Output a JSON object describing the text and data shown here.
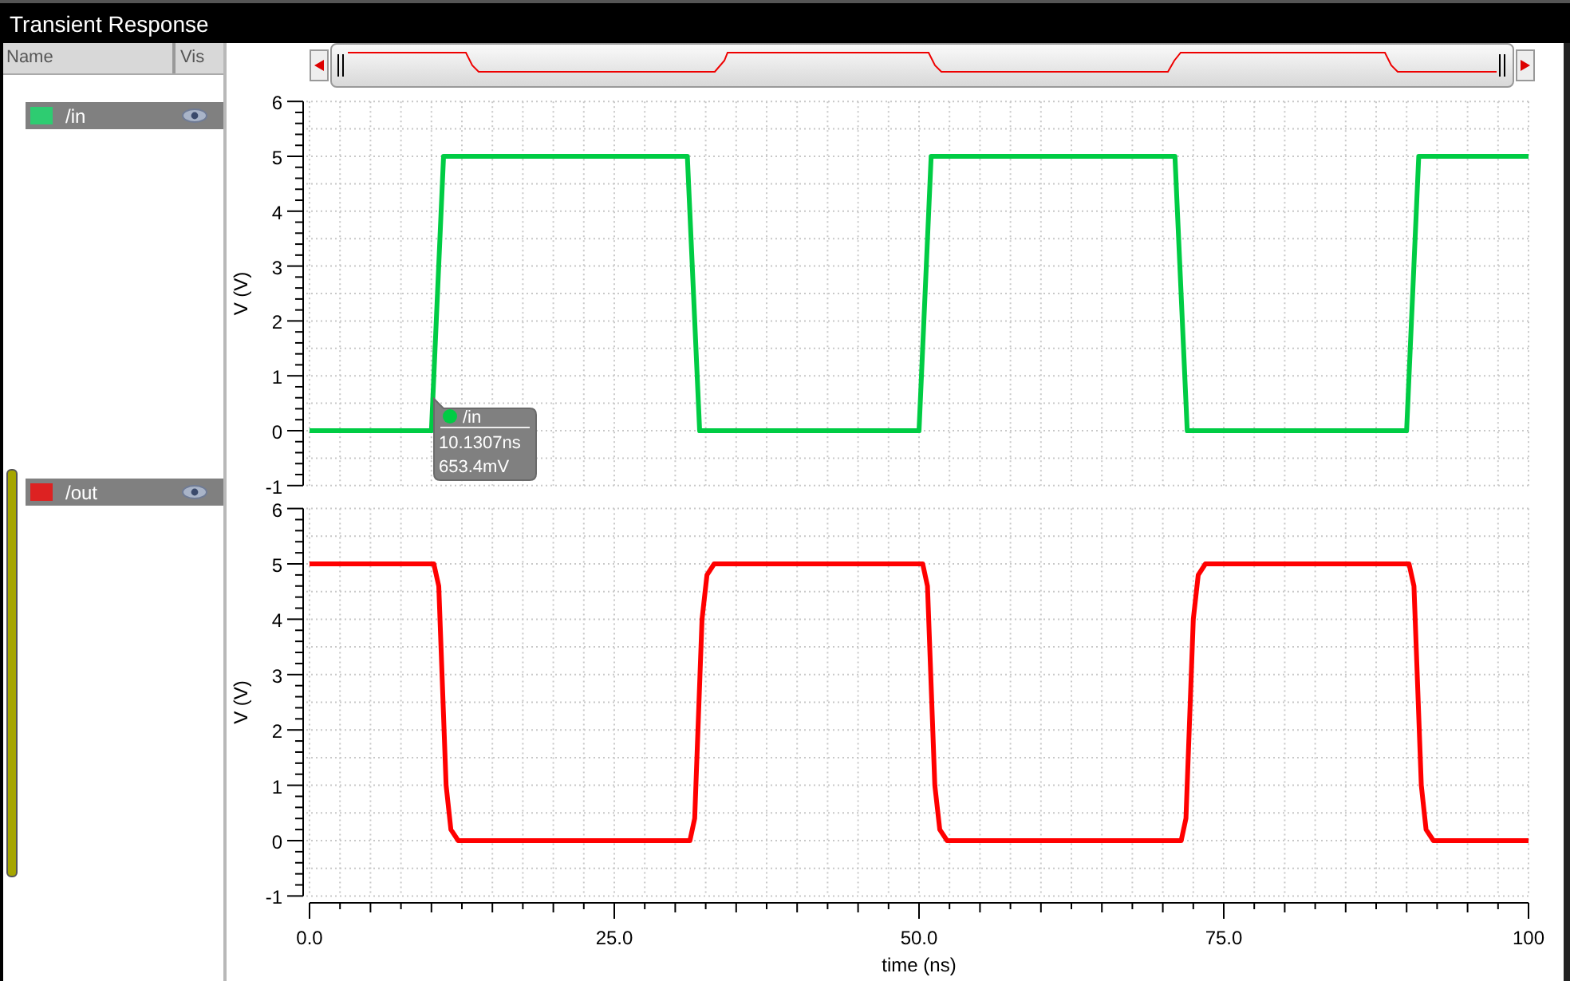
{
  "window": {
    "title": "Transient Response"
  },
  "signal_list": {
    "columns": [
      "Name",
      "Vis"
    ],
    "signals": [
      {
        "name": "/in",
        "color": "#2ecc71"
      },
      {
        "name": "/out",
        "color": "#dd2222"
      }
    ]
  },
  "plots": [
    {
      "chart_data": {
        "type": "line",
        "grid": true,
        "ylabel": "V (V)",
        "x": [
          0,
          10,
          11,
          31,
          32,
          50,
          51,
          71,
          72,
          90,
          91,
          100
        ],
        "series": [
          {
            "color": "#00cc44",
            "values": [
              0,
              0,
              5,
              5,
              0,
              0,
              5,
              5,
              0,
              0,
              5,
              5
            ]
          }
        ],
        "xlim": [
          0,
          100
        ],
        "ylim": [
          -1,
          6
        ],
        "yticks": [
          -1,
          0,
          1,
          2,
          3,
          4,
          5,
          6
        ]
      },
      "marker": {
        "signal": "/in",
        "time": "10.1307ns",
        "value": "653.4mV"
      }
    },
    {
      "chart_data": {
        "type": "line",
        "grid": true,
        "ylabel": "V (V)",
        "xlabel": "time (ns)",
        "x": [
          0,
          10.2,
          10.6,
          11.2,
          11.6,
          12.2,
          31.2,
          31.6,
          32.2,
          32.6,
          33.2,
          50.3,
          50.7,
          51.3,
          51.7,
          52.3,
          71.5,
          71.9,
          72.5,
          72.9,
          73.5,
          90.2,
          90.6,
          91.2,
          91.6,
          92.2,
          100
        ],
        "series": [
          {
            "color": "#ff0000",
            "values": [
              5,
              5,
              4.6,
              1,
              0.2,
              0,
              0,
              0.4,
              4,
              4.8,
              5,
              5,
              4.6,
              1,
              0.2,
              0,
              0,
              0.4,
              4,
              4.8,
              5,
              5,
              4.6,
              1,
              0.2,
              0,
              0
            ]
          }
        ],
        "xlim": [
          0,
          100
        ],
        "ylim": [
          -1,
          6
        ],
        "yticks": [
          -1,
          0,
          1,
          2,
          3,
          4,
          5,
          6
        ],
        "xticks": [
          {
            "value": 0,
            "label": "0.0"
          },
          {
            "value": 25,
            "label": "25.0"
          },
          {
            "value": 50,
            "label": "50.0"
          },
          {
            "value": 75,
            "label": "75.0"
          },
          {
            "value": 100,
            "label": "100"
          }
        ]
      }
    }
  ]
}
